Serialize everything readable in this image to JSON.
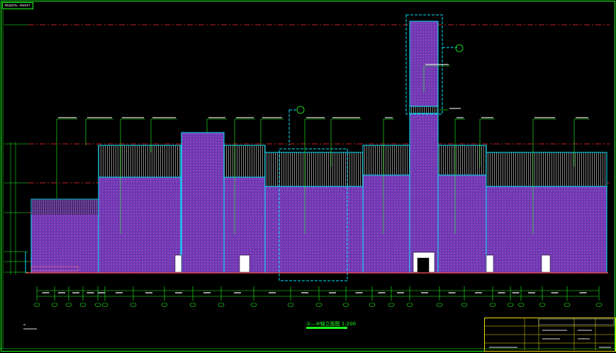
{
  "tab": {
    "label": "модель  макет"
  },
  "drawing": {
    "title": "①—⑩轴立面图",
    "scale": "1:200"
  },
  "colors": {
    "background": "#000000",
    "frame": "#1fff1f",
    "facade_fill": "#7a2a9e",
    "facade_hatch": "#4a7fff",
    "outline": "#00e5ff",
    "datum_line": "#ff2a2a",
    "title_block": "#f0e000",
    "grille": "#e0e0e0"
  }
}
